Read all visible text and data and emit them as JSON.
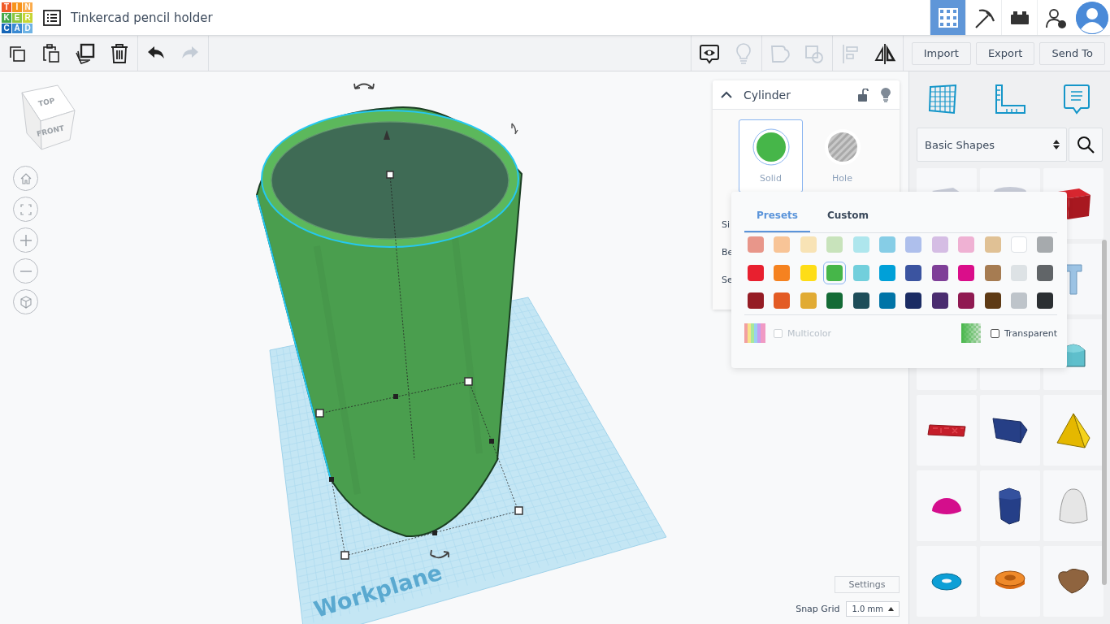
{
  "header": {
    "logo_letters": [
      {
        "text": "T",
        "color": "#f05a28"
      },
      {
        "text": "I",
        "color": "#f7941d"
      },
      {
        "text": "N",
        "color": "#fbab4b"
      },
      {
        "text": "K",
        "color": "#45a84a"
      },
      {
        "text": "E",
        "color": "#8dc63f"
      },
      {
        "text": "R",
        "color": "#c6d534"
      },
      {
        "text": "C",
        "color": "#1666b8"
      },
      {
        "text": "A",
        "color": "#3a8ad3"
      },
      {
        "text": "D",
        "color": "#6fb3e4"
      }
    ],
    "title": "Tinkercad pencil holder",
    "tools": [
      {
        "kind": "grid",
        "selected": true
      },
      {
        "kind": "pickaxe",
        "selected": false
      },
      {
        "kind": "brick",
        "selected": false
      },
      {
        "kind": "add-user",
        "selected": false
      }
    ]
  },
  "toolbar": {
    "left_tools": [
      {
        "kind": "copy",
        "disabled": false
      },
      {
        "kind": "paste",
        "disabled": false
      },
      {
        "kind": "duplicate",
        "disabled": false
      },
      {
        "kind": "delete",
        "disabled": false
      },
      {
        "kind": "undo",
        "disabled": false
      },
      {
        "kind": "redo",
        "disabled": true
      }
    ],
    "right_tools": [
      {
        "kind": "notes",
        "disabled": false
      },
      {
        "kind": "bulb",
        "disabled": true
      },
      {
        "kind": "group",
        "disabled": true
      },
      {
        "kind": "ungroup",
        "disabled": true
      },
      {
        "kind": "align",
        "disabled": true
      },
      {
        "kind": "mirror",
        "disabled": false
      }
    ],
    "buttons": [
      "Import",
      "Export",
      "Send To"
    ]
  },
  "viewport": {
    "view_cube": {
      "top": "TOP",
      "front": "FRONT"
    },
    "workplane_label": "Workplane",
    "settings_button": "Settings",
    "snap_grid": {
      "label": "Snap Grid",
      "value": "1.0 mm"
    }
  },
  "inspector": {
    "title": "Cylinder",
    "expanded": true,
    "modes": [
      {
        "label": "Solid",
        "selected": true
      },
      {
        "label": "Hole",
        "selected": false
      }
    ],
    "property_labels": [
      "Si",
      "Be",
      "Se"
    ]
  },
  "color_picker": {
    "tabs": [
      {
        "label": "Presets",
        "selected": true
      },
      {
        "label": "Custom",
        "selected": false
      }
    ],
    "swatches": [
      {
        "color": "#e8968a",
        "selected": false
      },
      {
        "color": "#f8c497",
        "selected": false
      },
      {
        "color": "#f8e3b5",
        "selected": false
      },
      {
        "color": "#c8e3bb",
        "selected": false
      },
      {
        "color": "#aee6ed",
        "selected": false
      },
      {
        "color": "#86cde6",
        "selected": false
      },
      {
        "color": "#aebfec",
        "selected": false
      },
      {
        "color": "#d5bde4",
        "selected": false
      },
      {
        "color": "#efb1d3",
        "selected": false
      },
      {
        "color": "#e0c195",
        "selected": false
      },
      {
        "color": "#ffffff",
        "selected": false
      },
      {
        "color": "#a6aaad",
        "selected": false
      },
      {
        "color": "#e8202f",
        "selected": false
      },
      {
        "color": "#f58220",
        "selected": false
      },
      {
        "color": "#fedd17",
        "selected": false
      },
      {
        "color": "#46b649",
        "selected": true
      },
      {
        "color": "#72cfdc",
        "selected": false
      },
      {
        "color": "#00a0d8",
        "selected": false
      },
      {
        "color": "#3b54a0",
        "selected": false
      },
      {
        "color": "#7f3f98",
        "selected": false
      },
      {
        "color": "#da0e8a",
        "selected": false
      },
      {
        "color": "#a67c52",
        "selected": false
      },
      {
        "color": "#dde2e5",
        "selected": false
      },
      {
        "color": "#616568",
        "selected": false
      },
      {
        "color": "#951c24",
        "selected": false
      },
      {
        "color": "#e35b24",
        "selected": false
      },
      {
        "color": "#e1ab34",
        "selected": false
      },
      {
        "color": "#146b36",
        "selected": false
      },
      {
        "color": "#1e4d59",
        "selected": false
      },
      {
        "color": "#0074a7",
        "selected": false
      },
      {
        "color": "#1b2c64",
        "selected": false
      },
      {
        "color": "#4a2c6f",
        "selected": false
      },
      {
        "color": "#901a52",
        "selected": false
      },
      {
        "color": "#5e3a15",
        "selected": false
      },
      {
        "color": "#bec4ca",
        "selected": false
      },
      {
        "color": "#2b2f32",
        "selected": false
      }
    ],
    "multicolor": {
      "label": "Multicolor",
      "checked": false,
      "disabled": true
    },
    "transparent": {
      "label": "Transparent",
      "checked": false
    }
  },
  "library": {
    "category": "Basic Shapes"
  }
}
